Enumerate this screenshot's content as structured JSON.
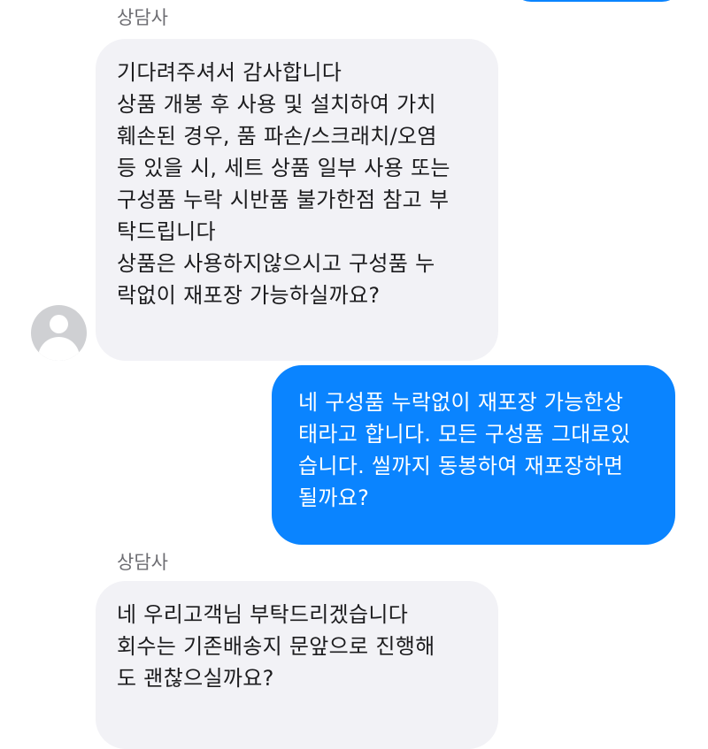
{
  "colors": {
    "sent_bubble": "#0a84ff",
    "received_bubble": "#f2f2f6",
    "sender_name": "#6d6d72",
    "avatar": "#cfd0d3"
  },
  "icons": {
    "avatar": "default-user-icon"
  },
  "messages": [
    {
      "direction": "received",
      "sender": "상담사",
      "lines": [
        "기다려주셔서 감사합니다",
        "상품 개봉 후 사용 및 설치하여 가치",
        "훼손된 경우, 품 파손/스크래치/오염",
        "등 있을 시, 세트 상품 일부 사용 또는",
        "구성품 누락 시반품 불가한점 참고 부",
        "탁드립니다",
        "상품은 사용하지않으시고 구성품 누",
        "락없이 재포장 가능하실까요?"
      ]
    },
    {
      "direction": "sent",
      "lines": [
        "네 구성품 누락없이 재포장 가능한상",
        "태라고 합니다. 모든 구성품 그대로있",
        "습니다. 씰까지 동봉하여 재포장하면",
        "될까요?"
      ]
    },
    {
      "direction": "received",
      "sender": "상담사",
      "lines": [
        "네 우리고객님 부탁드리겠습니다",
        "회수는 기존배송지 문앞으로 진행해",
        "도 괜찮으실까요?"
      ]
    }
  ]
}
